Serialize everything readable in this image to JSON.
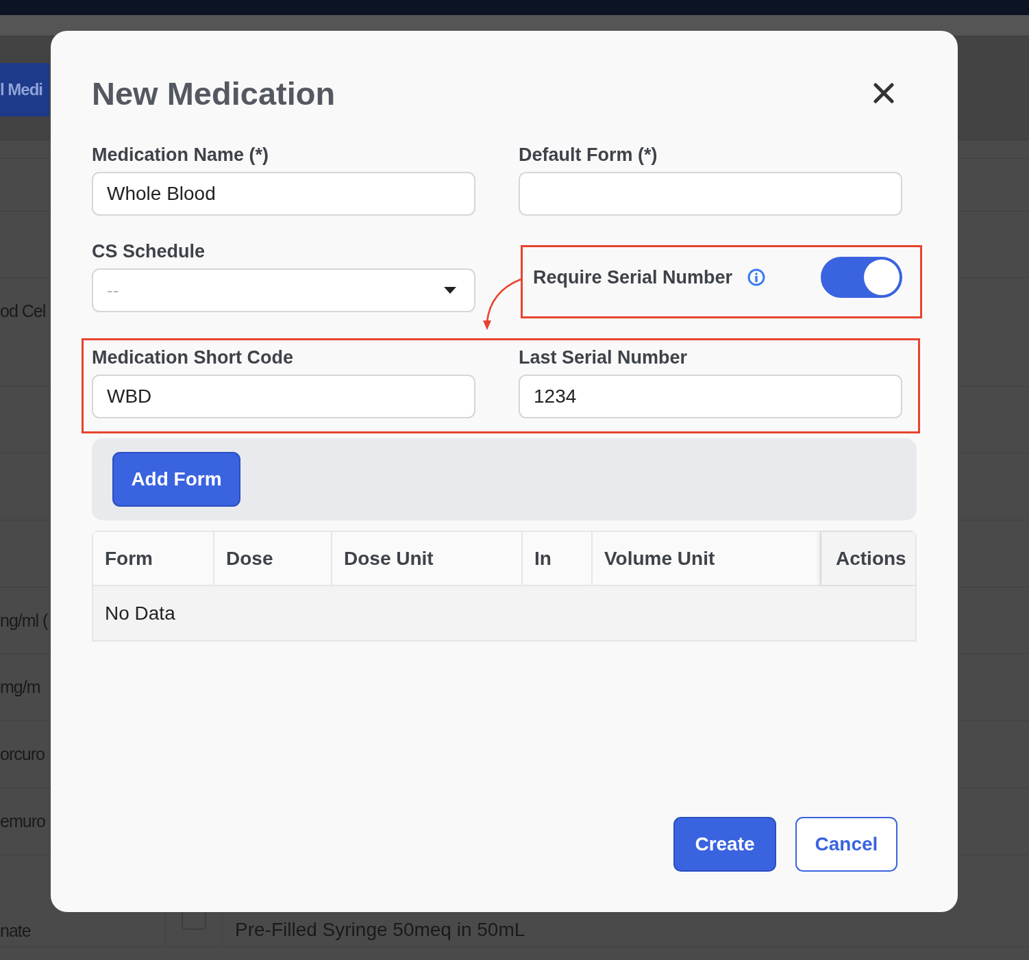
{
  "background": {
    "button": "l Medi",
    "rows": [
      "od Cel",
      "ng/ml (",
      "mg/m",
      "orcuro",
      "emuro",
      "nate"
    ],
    "bottom_checkbox": {
      "checked": false
    },
    "bottom_cell": "Pre-Filled Syringe 50meq in 50mL"
  },
  "modal": {
    "title": "New Medication",
    "fields": [
      {
        "label": "Medication Name (*)",
        "value": "Whole Blood"
      },
      {
        "label": "Default Form (*)"
      }
    ],
    "cs_schedule": {
      "label": "CS Schedule",
      "placeholder": "--"
    },
    "require_serial": {
      "label": "Require Serial Number",
      "on": true
    },
    "serial_fields": [
      {
        "label": "Medication Short Code",
        "value": "WBD"
      },
      {
        "label": "Last Serial Number",
        "value": "1234"
      }
    ],
    "add_button": "Add Form",
    "table": {
      "columns": [
        "Form",
        "Dose",
        "Dose Unit",
        "In",
        "Volume Unit",
        "Actions"
      ],
      "empty": "No Data"
    },
    "buttons": [
      {
        "label": "Create",
        "kind": "primary"
      },
      {
        "label": "Cancel",
        "kind": "secondary"
      }
    ]
  }
}
